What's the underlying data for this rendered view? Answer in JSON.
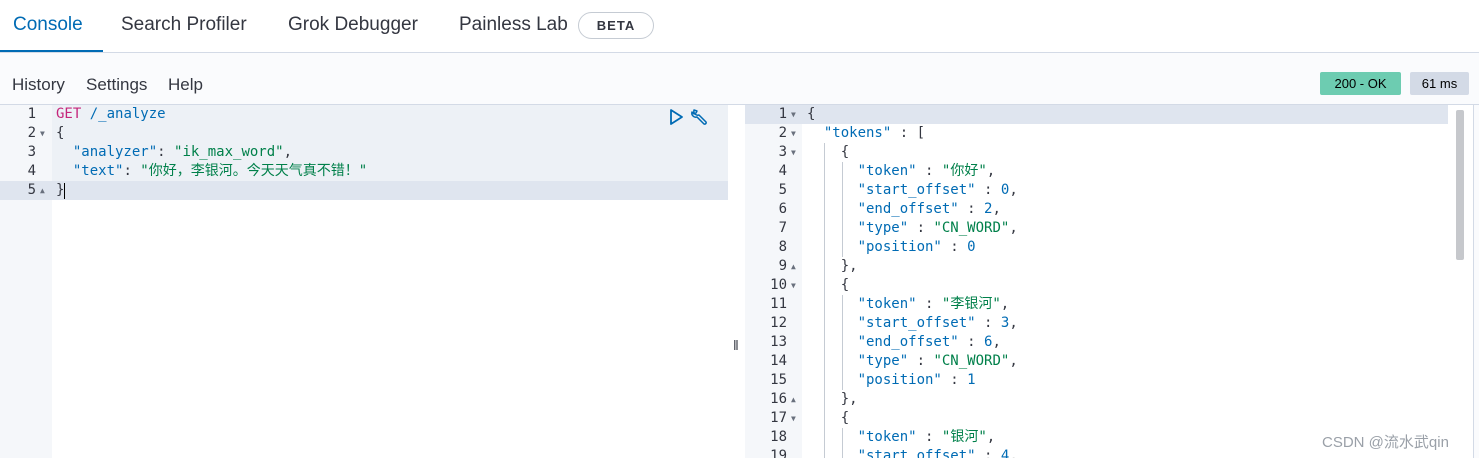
{
  "tabs": [
    {
      "label": "Console",
      "active": true
    },
    {
      "label": "Search Profiler"
    },
    {
      "label": "Grok Debugger"
    },
    {
      "label": "Painless Lab"
    }
  ],
  "beta_badge": "BETA",
  "menu": [
    "History",
    "Settings",
    "Help"
  ],
  "status": {
    "code": "200 - OK",
    "time": "61 ms"
  },
  "request": {
    "line_numbers": [
      "1",
      "2",
      "3",
      "4",
      "5"
    ],
    "lines": [
      {
        "method": "GET",
        "url": "/_analyze"
      },
      {
        "text": "{"
      },
      {
        "key": "\"analyzer\"",
        "sep": ": ",
        "value": "\"ik_max_word\"",
        "end": ","
      },
      {
        "key": "\"text\"",
        "sep": ": ",
        "value": "\"你好，李银河。今天天气真不错！\"",
        "end": ""
      },
      {
        "text": "}"
      }
    ]
  },
  "response": {
    "line_numbers": [
      "1",
      "2",
      "3",
      "4",
      "5",
      "6",
      "7",
      "8",
      "9",
      "10",
      "11",
      "12",
      "13",
      "14",
      "15",
      "16",
      "17",
      "18",
      "19"
    ],
    "lines": [
      "{",
      "  \"tokens\" : [",
      "    {",
      "      \"token\" : \"你好\",",
      "      \"start_offset\" : 0,",
      "      \"end_offset\" : 2,",
      "      \"type\" : \"CN_WORD\",",
      "      \"position\" : 0",
      "    },",
      "    {",
      "      \"token\" : \"李银河\",",
      "      \"start_offset\" : 3,",
      "      \"end_offset\" : 6,",
      "      \"type\" : \"CN_WORD\",",
      "      \"position\" : 1",
      "    },",
      "    {",
      "      \"token\" : \"银河\",",
      "      \"start_offset\" : 4,"
    ]
  },
  "watermark": "CSDN @流水武qin",
  "colors": {
    "accent": "#006bb4",
    "status_ok": "#6dccb1",
    "method": "#c5257b",
    "string": "#00804a"
  },
  "icons": [
    "play-icon",
    "wrench-icon",
    "resize-handle-icon"
  ]
}
